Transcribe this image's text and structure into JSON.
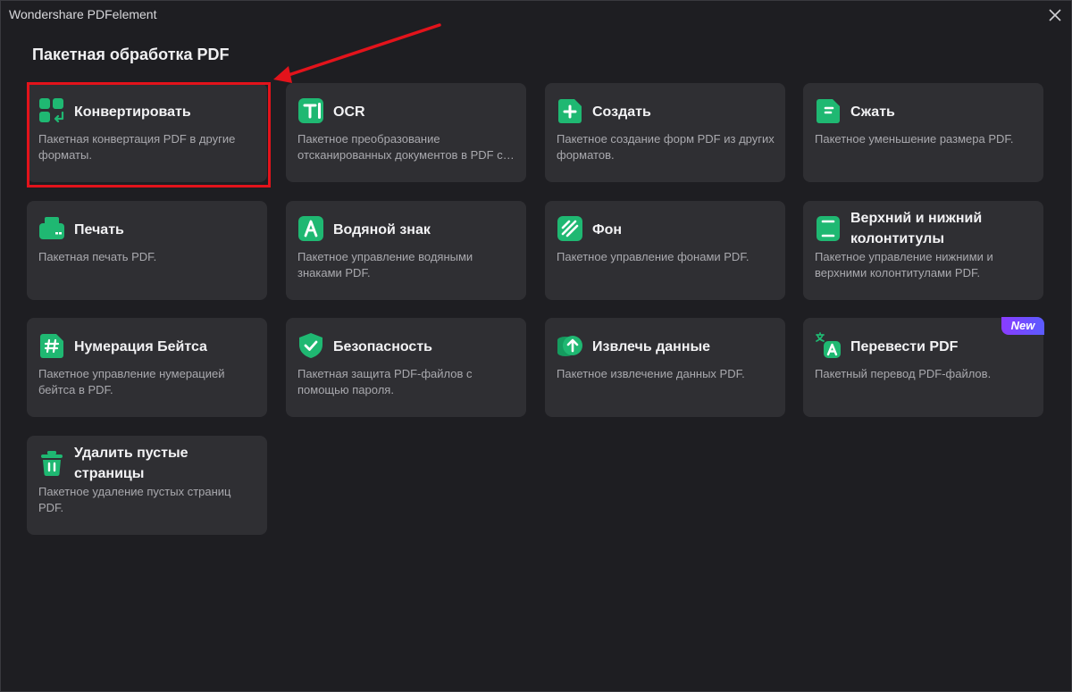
{
  "window": {
    "title": "Wondershare PDFelement",
    "close_icon": "close-icon"
  },
  "page": {
    "title": "Пакетная обработка PDF"
  },
  "colors": {
    "background": "#1e1e22",
    "card": "#2f2f33",
    "accent_green": "#1fb872",
    "highlight_red": "#e3131b",
    "badge_gradient": [
      "#8a3cff",
      "#5b5cff"
    ]
  },
  "cards": [
    {
      "title": "Конвертировать",
      "desc": "Пакетная конвертация PDF в другие форматы.",
      "icon": "convert-icon"
    },
    {
      "title": "OCR",
      "desc": "Пакетное преобразование отсканированных документов в PDF с возможностью редактирования.",
      "icon": "ocr-icon"
    },
    {
      "title": "Создать",
      "desc": "Пакетное создание форм PDF из других форматов.",
      "icon": "create-icon"
    },
    {
      "title": "Сжать",
      "desc": "Пакетное уменьшение размера PDF.",
      "icon": "compress-icon"
    },
    {
      "title": "Печать",
      "desc": "Пакетная печать PDF.",
      "icon": "print-icon"
    },
    {
      "title": "Водяной знак",
      "desc": "Пакетное управление водяными знаками PDF.",
      "icon": "watermark-icon"
    },
    {
      "title": "Фон",
      "desc": "Пакетное управление фонами PDF.",
      "icon": "background-icon"
    },
    {
      "title": "Верхний и нижний колонтитулы",
      "desc": "Пакетное управление нижними и верхними колонтитулами PDF.",
      "icon": "header-footer-icon"
    },
    {
      "title": "Нумерация Бейтса",
      "desc": "Пакетное управление нумерацией бейтса в PDF.",
      "icon": "bates-number-icon"
    },
    {
      "title": "Безопасность",
      "desc": "Пакетная защита PDF-файлов с помощью пароля.",
      "icon": "security-shield-icon"
    },
    {
      "title": "Извлечь данные",
      "desc": "Пакетное извлечение данных PDF.",
      "icon": "extract-data-icon"
    },
    {
      "title": "Перевести PDF",
      "desc": "Пакетный перевод PDF-файлов.",
      "icon": "translate-icon",
      "badge": "New"
    },
    {
      "title": "Удалить пустые страницы",
      "desc": "Пакетное удаление пустых страниц PDF.",
      "icon": "trash-icon"
    }
  ]
}
